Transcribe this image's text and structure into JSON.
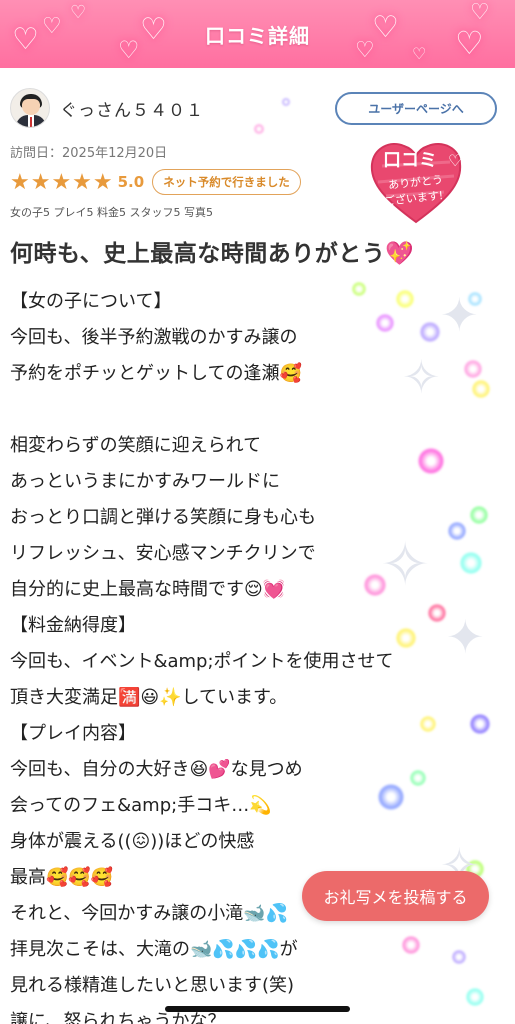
{
  "header": {
    "title": "口コミ詳細"
  },
  "reviewer": {
    "name": "ぐっさん５４０１",
    "user_page_label": "ユーザーページへ"
  },
  "stamp": {
    "line1": "口コミ",
    "line2": "ありがとう",
    "line3": "ございます!"
  },
  "visit_date": "訪問日：2025年12月20日",
  "rating": {
    "stars": "★★★★★",
    "score": "5.0",
    "badge": "ネット予約で行きました",
    "sub": "女の子5 プレイ5 料金5 スタッフ5 写真5"
  },
  "review": {
    "title": "何時も、史上最高な時間ありがとう💖",
    "lines": [
      "【女の子について】",
      "今回も、後半予約激戦のかすみ譲の",
      "予約をポチッとゲットしての逢瀬🥰",
      "",
      "相変わらずの笑顔に迎えられて",
      "あっというまにかすみワールドに",
      "おっとり口調と弾ける笑顔に身も心も",
      "リフレッシュ、安心感マンチクリンで",
      "自分的に史上最高な時間です😌💓",
      "【料金納得度】",
      "今回も、イベント&amp;ポイントを使用させて",
      "頂き大変満足🈵😃✨しています。",
      "【プレイ内容】",
      "今回も、自分の大好き😆💕な見つめ",
      "会ってのフェ&amp;手コキ…💫",
      "身体が震える((😖))ほどの快感",
      "最高🥰🥰🥰",
      "それと、今回かすみ譲の小滝🐋💦",
      "拝見次こそは、大滝の🐋💦💦💦が",
      "見れる様精進したいと思います(笑)",
      "譲に、怒られちゃうかな？"
    ]
  },
  "post_photo_button": "お礼写メを投稿する",
  "colors": {
    "header_pink": "#ff7aa8",
    "star_orange": "#e89a3c",
    "link_blue": "#5b84b8",
    "cta_red": "#ec6a6a"
  }
}
